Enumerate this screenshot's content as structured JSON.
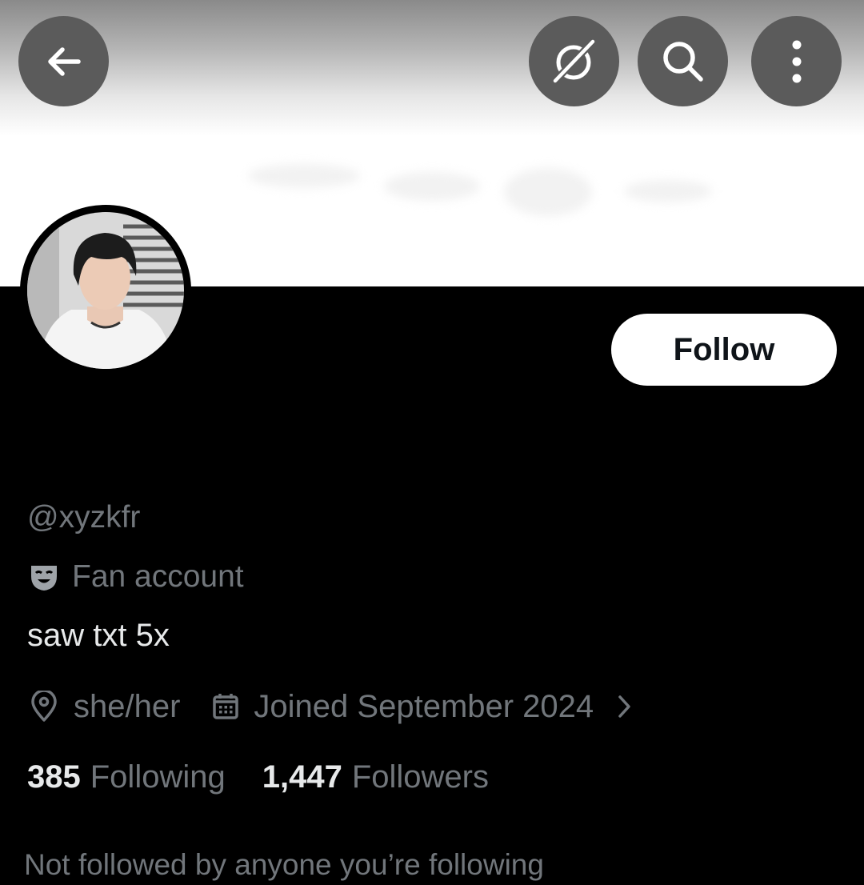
{
  "header": {
    "back_icon": "arrow-left-icon",
    "grok_icon": "grok-icon",
    "search_icon": "search-icon",
    "more_icon": "more-vertical-icon"
  },
  "profile": {
    "handle": "@xyzkfr",
    "label_icon": "theater-mask-icon",
    "label": "Fan account",
    "bio": "saw txt 5x",
    "location_icon": "location-pin-icon",
    "location": "she/her",
    "joined_icon": "calendar-icon",
    "joined": "Joined September 2024",
    "following_count": "385",
    "following_label": "Following",
    "followers_count": "1,447",
    "followers_label": "Followers",
    "not_followed": "Not followed by anyone you’re following"
  },
  "actions": {
    "follow_label": "Follow"
  },
  "colors": {
    "background": "#000000",
    "primary_text": "#e7e9ea",
    "secondary_text": "#71767b",
    "button_bg": "#ffffff",
    "button_text": "#0f1419",
    "overlay_button": "#5b5b5b"
  }
}
